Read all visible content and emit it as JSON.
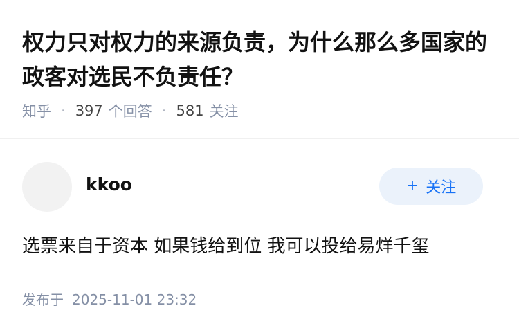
{
  "question": {
    "title": "权力只对权力的来源负责，为什么那么多国家的政客对选民不负责任？"
  },
  "meta": {
    "source": "知乎",
    "answer_count": "397",
    "answer_label": "个回答",
    "follower_count": "581",
    "follower_label": "关注"
  },
  "author": {
    "name": "kkoo",
    "follow_icon": "plus-icon",
    "follow_symbol": "+",
    "follow_label": "关注"
  },
  "answer": {
    "content": "选票来自于资本 如果钱给到位 我可以投给易烊千玺"
  },
  "footer": {
    "published_label": "发布于",
    "published_time": "2025-11-01 23:32"
  },
  "colors": {
    "accent": "#1772f6",
    "follow_bg": "#ebf2fb",
    "meta_text": "#8590a6",
    "title_text": "#121212"
  }
}
